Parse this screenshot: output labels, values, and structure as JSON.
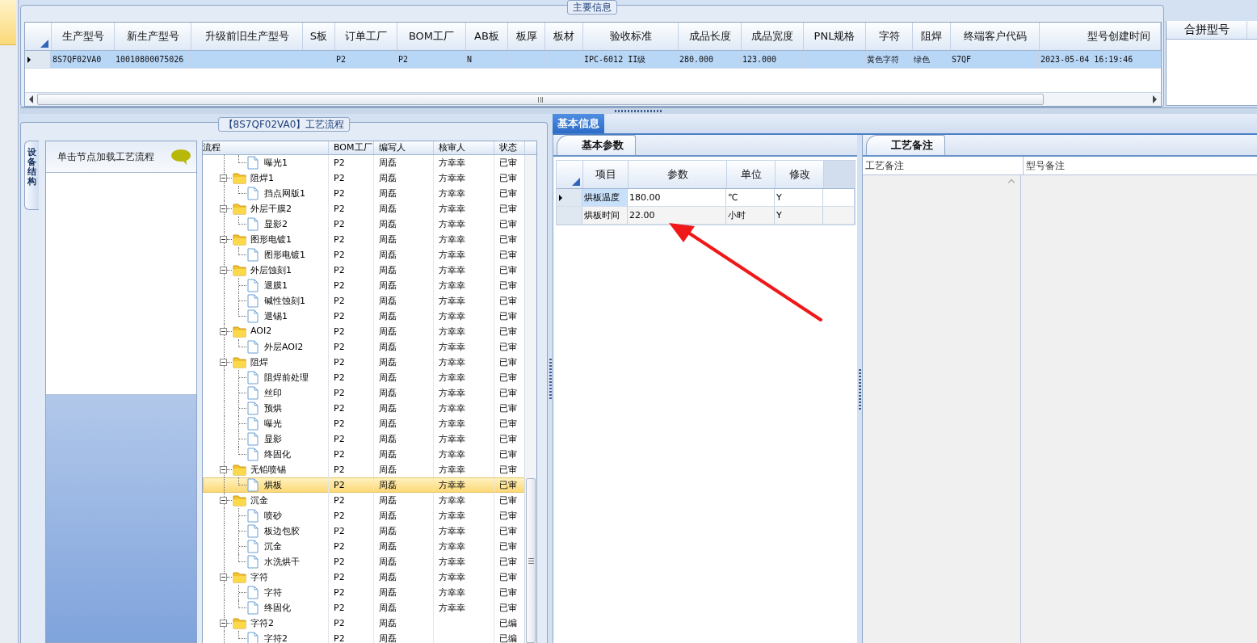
{
  "main_info": {
    "title": "主要信息",
    "columns": [
      "生产型号",
      "新生产型号",
      "升级前旧生产型号",
      "S板",
      "订单工厂",
      "BOM工厂",
      "AB板",
      "板厚",
      "板材",
      "验收标准",
      "成品长度",
      "成品宽度",
      "PNL规格",
      "字符",
      "阻焊",
      "终端客户代码",
      "型号创建时间"
    ],
    "rows": [
      {
        "selected": true,
        "cells": [
          "8S7QF02VA0",
          "10010800075026",
          null,
          null,
          "P2",
          "P2",
          "N",
          null,
          null,
          "IPC-6012 II级",
          "280.000",
          "123.000",
          null,
          "黄色字符",
          "绿色",
          "S7QF",
          "2023-05-04 16:19:46"
        ]
      }
    ]
  },
  "merge_panel": {
    "columns": [
      "合拼型号"
    ]
  },
  "process_flow": {
    "title": "【8S7QF02VA0】工艺流程",
    "side_tabs": [
      {
        "label": "设备结构",
        "selected": true
      }
    ],
    "hint": "单击节点加载工艺流程",
    "tree": {
      "columns": [
        "流程",
        "BOM工厂",
        "编写人",
        "核审人",
        "状态"
      ],
      "continued_children": [
        {
          "name": "曝光1",
          "bom_factory": "P2",
          "writer": "周磊",
          "reviewer": "方幸幸",
          "status": "已审",
          "selected": false
        }
      ],
      "nodes": [
        {
          "name": "阻焊1",
          "bom_factory": "P2",
          "writer": "周磊",
          "reviewer": "方幸幸",
          "status": "已审",
          "selected": false,
          "expanded": true,
          "children": [
            {
              "name": "挡点网版1",
              "bom_factory": "P2",
              "writer": "周磊",
              "reviewer": "方幸幸",
              "status": "已审",
              "selected": false
            }
          ]
        },
        {
          "name": "外层干膜2",
          "bom_factory": "P2",
          "writer": "周磊",
          "reviewer": "方幸幸",
          "status": "已审",
          "selected": false,
          "expanded": true,
          "children": [
            {
              "name": "显影2",
              "bom_factory": "P2",
              "writer": "周磊",
              "reviewer": "方幸幸",
              "status": "已审",
              "selected": false
            }
          ]
        },
        {
          "name": "图形电镀1",
          "bom_factory": "P2",
          "writer": "周磊",
          "reviewer": "方幸幸",
          "status": "已审",
          "selected": false,
          "expanded": true,
          "children": [
            {
              "name": "图形电镀1",
              "bom_factory": "P2",
              "writer": "周磊",
              "reviewer": "方幸幸",
              "status": "已审",
              "selected": false
            }
          ]
        },
        {
          "name": "外层蚀刻1",
          "bom_factory": "P2",
          "writer": "周磊",
          "reviewer": "方幸幸",
          "status": "已审",
          "selected": false,
          "expanded": true,
          "children": [
            {
              "name": "退膜1",
              "bom_factory": "P2",
              "writer": "周磊",
              "reviewer": "方幸幸",
              "status": "已审",
              "selected": false
            },
            {
              "name": "碱性蚀刻1",
              "bom_factory": "P2",
              "writer": "周磊",
              "reviewer": "方幸幸",
              "status": "已审",
              "selected": false
            },
            {
              "name": "退锡1",
              "bom_factory": "P2",
              "writer": "周磊",
              "reviewer": "方幸幸",
              "status": "已审",
              "selected": false
            }
          ]
        },
        {
          "name": "AOI2",
          "bom_factory": "P2",
          "writer": "周磊",
          "reviewer": "方幸幸",
          "status": "已审",
          "selected": false,
          "expanded": true,
          "children": [
            {
              "name": "外层AOI2",
              "bom_factory": "P2",
              "writer": "周磊",
              "reviewer": "方幸幸",
              "status": "已审",
              "selected": false
            }
          ]
        },
        {
          "name": "阻焊",
          "bom_factory": "P2",
          "writer": "周磊",
          "reviewer": "方幸幸",
          "status": "已审",
          "selected": false,
          "expanded": true,
          "children": [
            {
              "name": "阻焊前处理",
              "bom_factory": "P2",
              "writer": "周磊",
              "reviewer": "方幸幸",
              "status": "已审",
              "selected": false
            },
            {
              "name": "丝印",
              "bom_factory": "P2",
              "writer": "周磊",
              "reviewer": "方幸幸",
              "status": "已审",
              "selected": false
            },
            {
              "name": "预烘",
              "bom_factory": "P2",
              "writer": "周磊",
              "reviewer": "方幸幸",
              "status": "已审",
              "selected": false
            },
            {
              "name": "曝光",
              "bom_factory": "P2",
              "writer": "周磊",
              "reviewer": "方幸幸",
              "status": "已审",
              "selected": false
            },
            {
              "name": "显影",
              "bom_factory": "P2",
              "writer": "周磊",
              "reviewer": "方幸幸",
              "status": "已审",
              "selected": false
            },
            {
              "name": "终固化",
              "bom_factory": "P2",
              "writer": "周磊",
              "reviewer": "方幸幸",
              "status": "已审",
              "selected": false
            }
          ]
        },
        {
          "name": "无铅喷锡",
          "bom_factory": "P2",
          "writer": "周磊",
          "reviewer": "方幸幸",
          "status": "已审",
          "selected": false,
          "expanded": true,
          "children": [
            {
              "name": "烘板",
              "bom_factory": "P2",
              "writer": "周磊",
              "reviewer": "方幸幸",
              "status": "已审",
              "selected": true
            }
          ]
        },
        {
          "name": "沉金",
          "bom_factory": "P2",
          "writer": "周磊",
          "reviewer": "方幸幸",
          "status": "已审",
          "selected": false,
          "expanded": true,
          "children": [
            {
              "name": "喷砂",
              "bom_factory": "P2",
              "writer": "周磊",
              "reviewer": "方幸幸",
              "status": "已审",
              "selected": false
            },
            {
              "name": "板边包胶",
              "bom_factory": "P2",
              "writer": "周磊",
              "reviewer": "方幸幸",
              "status": "已审",
              "selected": false
            },
            {
              "name": "沉金",
              "bom_factory": "P2",
              "writer": "周磊",
              "reviewer": "方幸幸",
              "status": "已审",
              "selected": false
            },
            {
              "name": "水洗烘干",
              "bom_factory": "P2",
              "writer": "周磊",
              "reviewer": "方幸幸",
              "status": "已审",
              "selected": false
            }
          ]
        },
        {
          "name": "字符",
          "bom_factory": "P2",
          "writer": "周磊",
          "reviewer": "方幸幸",
          "status": "已审",
          "selected": false,
          "expanded": true,
          "children": [
            {
              "name": "字符",
              "bom_factory": "P2",
              "writer": "周磊",
              "reviewer": "方幸幸",
              "status": "已审",
              "selected": false
            },
            {
              "name": "终固化",
              "bom_factory": "P2",
              "writer": "周磊",
              "reviewer": "方幸幸",
              "status": "已审",
              "selected": false
            }
          ]
        },
        {
          "name": "字符2",
          "bom_factory": "P2",
          "writer": "周磊",
          "status": "已编",
          "selected": false,
          "expanded": true,
          "children": [
            {
              "name": "字符2",
              "bom_factory": "P2",
              "writer": "周磊",
              "status": "已编",
              "selected": false
            }
          ]
        }
      ]
    }
  },
  "detail": {
    "tabs": [
      {
        "label": "基本信息",
        "selected": true
      }
    ],
    "params": {
      "tabs": [
        {
          "label": "基本参数",
          "selected": true
        }
      ],
      "columns": [
        "项目",
        "参数",
        "单位",
        "修改"
      ],
      "rows": [
        {
          "selected": true,
          "cells": [
            "烘板温度",
            "180.00",
            "℃",
            "Y"
          ]
        },
        {
          "selected": false,
          "cells": [
            "烘板时间",
            "22.00",
            "小时",
            "Y"
          ]
        }
      ]
    },
    "notes": {
      "tabs": [
        {
          "label": "工艺备注",
          "selected": true
        }
      ],
      "columns": [
        "工艺备注",
        "型号备注"
      ]
    }
  }
}
